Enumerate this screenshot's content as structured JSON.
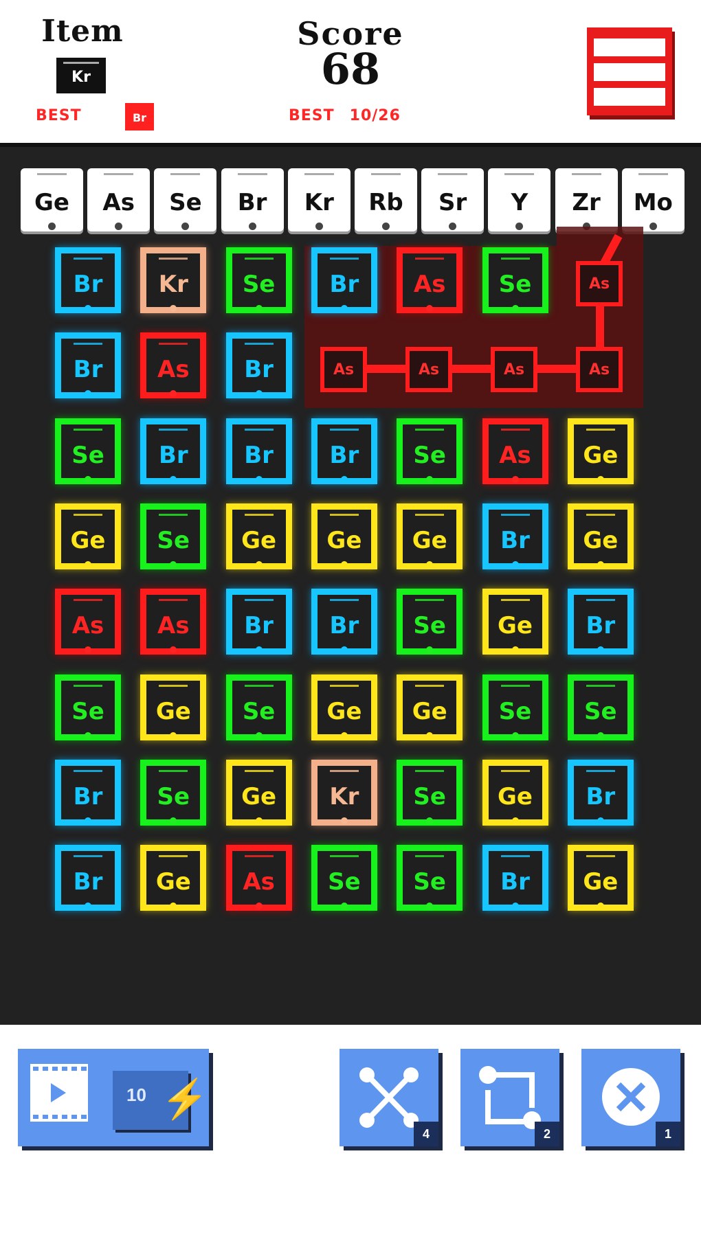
{
  "header": {
    "item_title": "Item",
    "item_symbol": "Kr",
    "best_label": "BEST",
    "best_item_symbol": "Br",
    "score_title": "Score",
    "score_value": "68",
    "best_score_label": "BEST",
    "best_score_value": "10/26"
  },
  "periodic_row": [
    "Ge",
    "As",
    "Se",
    "Br",
    "Kr",
    "Rb",
    "Sr",
    "Y",
    "Zr",
    "Mo"
  ],
  "board": {
    "rows": [
      [
        "Br",
        "Kr",
        "Se",
        "Br",
        "As",
        "Se",
        ""
      ],
      [
        "Br",
        "As",
        "Br",
        "",
        "",
        "",
        ""
      ],
      [
        "Se",
        "Br",
        "Br",
        "Br",
        "Se",
        "As",
        "Ge"
      ],
      [
        "Ge",
        "Se",
        "Ge",
        "Ge",
        "Ge",
        "Br",
        "Ge"
      ],
      [
        "As",
        "As",
        "Br",
        "Br",
        "Se",
        "Ge",
        "Br"
      ],
      [
        "Se",
        "Ge",
        "Se",
        "Ge",
        "Ge",
        "Se",
        "Se"
      ],
      [
        "Br",
        "Se",
        "Ge",
        "Kr",
        "Se",
        "Ge",
        "Br"
      ],
      [
        "Br",
        "Ge",
        "As",
        "Se",
        "Se",
        "Br",
        "Ge"
      ]
    ],
    "selected_chain": [
      "As",
      "As",
      "As",
      "As",
      "As"
    ]
  },
  "toolbar": {
    "video_count": "10",
    "shuffle_count": "4",
    "swap_count": "2",
    "remove_count": "1"
  },
  "colors": {
    "Br": "#17c6ff",
    "Se": "#18f21c",
    "Ge": "#ffe61a",
    "As": "#ff1c1c",
    "Kr": "#f3b08a",
    "board_bg": "#222222",
    "tool_bg": "#5e95ee"
  },
  "icons": [
    "menu-icon",
    "video-icon",
    "lightning-icon",
    "shuffle-icon",
    "swap-icon",
    "remove-icon"
  ]
}
